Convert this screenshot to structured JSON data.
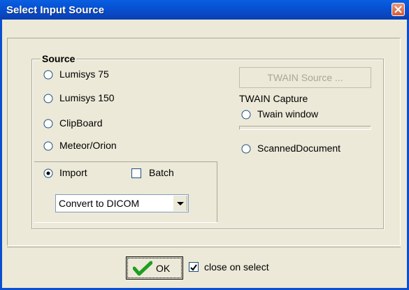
{
  "window": {
    "title": "Select Input Source"
  },
  "source_group": {
    "legend": "Source",
    "options": [
      {
        "label": "Lumisys 75",
        "selected": false
      },
      {
        "label": "Lumisys 150",
        "selected": false
      },
      {
        "label": "ClipBoard",
        "selected": false
      },
      {
        "label": "Meteor/Orion",
        "selected": false
      }
    ],
    "import": {
      "label": "Import",
      "selected": true
    },
    "batch": {
      "label": "Batch",
      "checked": false
    },
    "convert_select": {
      "value": "Convert to DICOM"
    },
    "twain_source_button": {
      "label": "TWAIN Source ...",
      "enabled": false
    },
    "twain_capture_label": "TWAIN Capture",
    "twain_window": {
      "label": "Twain window",
      "selected": false
    },
    "scanned_document": {
      "label": "ScannedDocument",
      "selected": false
    }
  },
  "footer": {
    "ok_label": "OK",
    "close_on_select": {
      "label": "close on select",
      "checked": true
    }
  }
}
